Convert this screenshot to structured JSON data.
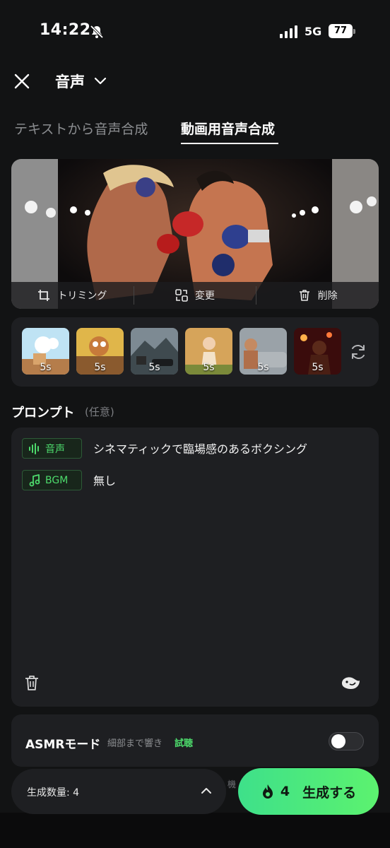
{
  "status_bar": {
    "time": "14:22",
    "network": "5G",
    "battery": "77",
    "icons": [
      "bell-slash-icon",
      "signal-icon",
      "battery-icon"
    ]
  },
  "header": {
    "title": "音声",
    "close_icon": "close-icon",
    "dropdown_icon": "chevron-down-icon"
  },
  "tabs": [
    {
      "label": "テキストから音声合成",
      "active": false
    },
    {
      "label": "動画用音声合成",
      "active": true
    }
  ],
  "preview": {
    "toolbar": [
      {
        "label": "トリミング",
        "icon": "crop-icon"
      },
      {
        "label": "変更",
        "icon": "swap-icon"
      },
      {
        "label": "削除",
        "icon": "trash-icon"
      }
    ]
  },
  "style_strip": {
    "items": [
      {
        "duration": "5s"
      },
      {
        "duration": "5s"
      },
      {
        "duration": "5s"
      },
      {
        "duration": "5s"
      },
      {
        "duration": "5s"
      },
      {
        "duration": "5s"
      }
    ],
    "refresh_icon": "refresh-icon"
  },
  "prompt": {
    "label": "プロンプト",
    "optional": "(任意)",
    "voice_chip": "音声",
    "voice_text": "シネマティックで臨場感のあるボクシング",
    "bgm_chip": "BGM",
    "bgm_text": "無し"
  },
  "asmr": {
    "title": "ASMRモード",
    "subtitle": "細部まで響き",
    "trial": "試聴",
    "enabled": false
  },
  "bottom": {
    "count_label": "生成数量: 4",
    "peek_text": "機",
    "generate_cost": "4",
    "generate_label": "生成する"
  },
  "colors": {
    "background": "#121314",
    "panel": "#1e1f22",
    "accent": "#4ddb6c"
  }
}
